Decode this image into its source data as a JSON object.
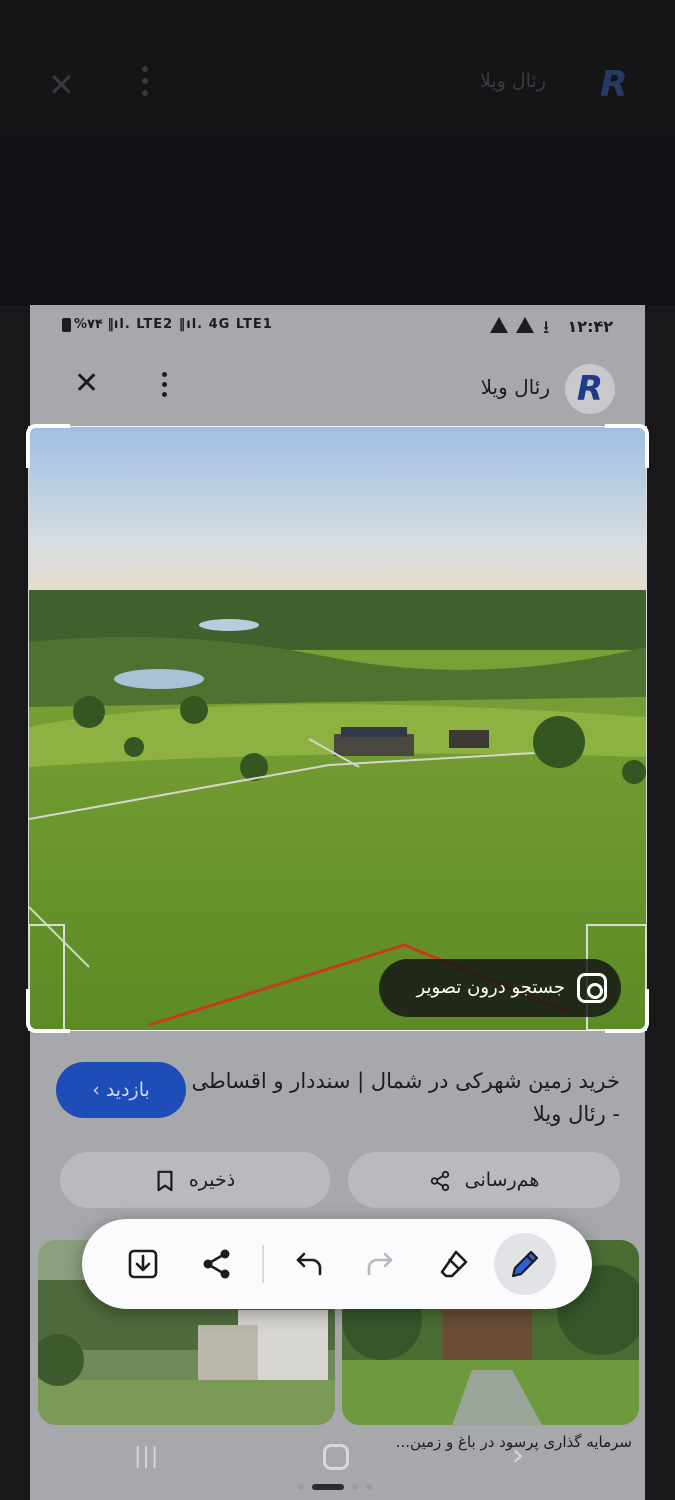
{
  "background_app": {
    "title": "رئال ویلا"
  },
  "status_bar": {
    "time": "۱۲:۴۲",
    "right_indicators": "%۷۴ ‖ıl. LTE2 ‖ıl. 4G LTE1"
  },
  "app_header": {
    "title": "رئال ویلا",
    "logo_letter": "R"
  },
  "article": {
    "title": "خرید زمین شهرکی در شمال | سنددار و اقساطی - رئال ویلا",
    "visit_label": "بازدید ›",
    "share_label": "هم‌رسانی",
    "save_label": "ذخیره"
  },
  "related": {
    "right_caption": "سرمایه گذاری پرسود در باغ و زمین..."
  },
  "lens": {
    "label": "جستجو درون تصویر"
  },
  "toolbar": {
    "items": [
      "save-image",
      "share",
      "undo",
      "redo",
      "eraser",
      "pen"
    ],
    "active": "pen"
  },
  "colors": {
    "accent_blue": "#1f4db8",
    "toolbar_bg": "#fbfbfd",
    "panel_bg": "#a7a8ab"
  }
}
